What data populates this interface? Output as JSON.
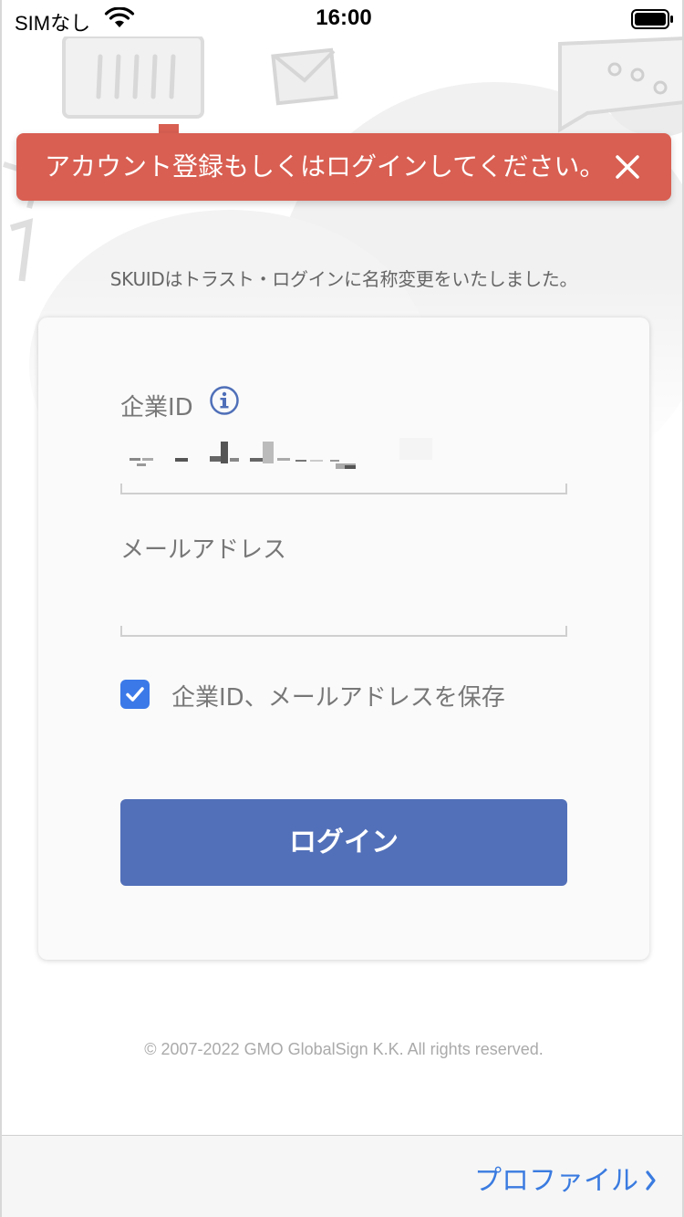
{
  "status_bar": {
    "carrier": "SIMなし",
    "time": "16:00"
  },
  "toast": {
    "message": "アカウント登録もしくはログインしてください。",
    "color": "#d85f52"
  },
  "notice": "SKUIDはトラスト・ログインに名称変更をいたしました。",
  "form": {
    "company_id_label": "企業ID",
    "company_id_value": "",
    "email_label": "メールアドレス",
    "email_value": "",
    "remember_label": "企業ID、メールアドレスを保存",
    "remember_checked": true,
    "login_button": "ログイン",
    "button_color": "#5270b9"
  },
  "footer": {
    "copyright": "© 2007-2022 GMO GlobalSign K.K. All rights reserved."
  },
  "bottom_bar": {
    "profile_link": "プロファイル"
  }
}
